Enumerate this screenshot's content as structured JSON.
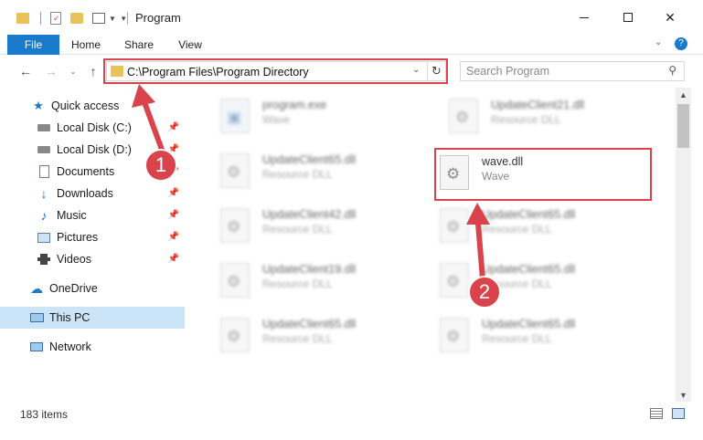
{
  "window": {
    "title": "Program"
  },
  "ribbon": {
    "tabs": [
      "File",
      "Home",
      "Share",
      "View"
    ]
  },
  "address": {
    "path": "C:\\Program Files\\Program Directory"
  },
  "search": {
    "placeholder": "Search Program"
  },
  "sidebar": {
    "items": [
      {
        "label": "Quick access",
        "icon": "star-icon",
        "pinned": false
      },
      {
        "label": "Local Disk (C:)",
        "icon": "drive-icon",
        "pinned": true
      },
      {
        "label": "Local Disk (D:)",
        "icon": "drive-icon",
        "pinned": true
      },
      {
        "label": "Documents",
        "icon": "documents-icon",
        "pinned": true
      },
      {
        "label": "Downloads",
        "icon": "download-icon",
        "pinned": true
      },
      {
        "label": "Music",
        "icon": "music-icon",
        "pinned": true
      },
      {
        "label": "Pictures",
        "icon": "pictures-icon",
        "pinned": true
      },
      {
        "label": "Videos",
        "icon": "videos-icon",
        "pinned": true
      },
      {
        "label": "OneDrive",
        "icon": "cloud-icon",
        "pinned": false
      },
      {
        "label": "This PC",
        "icon": "computer-icon",
        "pinned": false,
        "selected": true
      },
      {
        "label": "Network",
        "icon": "network-icon",
        "pinned": false
      }
    ]
  },
  "files": [
    {
      "name": "program.exe",
      "type": "Wave"
    },
    {
      "name": "UpdateClient21.dll",
      "type": "Resource DLL"
    },
    {
      "name": "UpdateClient65.dll",
      "type": "Resource DLL"
    },
    {
      "name": "wave.dll",
      "type": "Wave"
    },
    {
      "name": "UpdateClient42.dll",
      "type": "Resource DLL"
    },
    {
      "name": "UpdateClient65.dll",
      "type": "Resource DLL"
    },
    {
      "name": "UpdateClient19.dll",
      "type": "Resource DLL"
    },
    {
      "name": "UpdateClient65.dll",
      "type": "Resource DLL"
    },
    {
      "name": "UpdateClient65.dll",
      "type": "Resource DLL"
    },
    {
      "name": "UpdateClient65.dll",
      "type": "Resource DLL"
    }
  ],
  "status": {
    "item_count": "183 items"
  },
  "callouts": [
    "1",
    "2"
  ],
  "colors": {
    "accent": "#1979ca",
    "highlight": "#d9434c",
    "selected": "#cce4f7"
  }
}
